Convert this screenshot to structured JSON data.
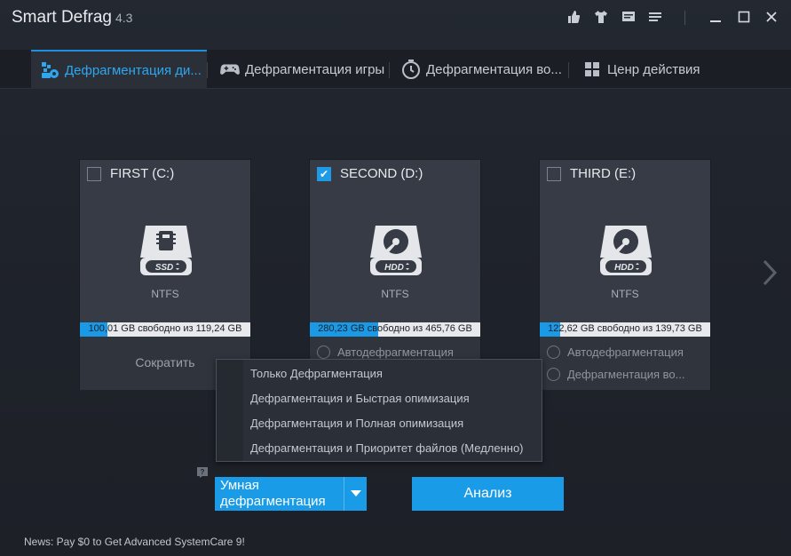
{
  "window": {
    "title": "Smart Defrag",
    "version": "4.3"
  },
  "toolbar_icons": [
    "thumbs-up-icon",
    "tshirt-icon",
    "message-icon",
    "menu-icon"
  ],
  "tabs": [
    {
      "label": "Дефрагментация ди...",
      "icon": "defrag-disk-icon",
      "active": true
    },
    {
      "label": "Дефрагментация игры",
      "icon": "gamepad-icon",
      "active": false
    },
    {
      "label": "Дефрагментация во...",
      "icon": "clock-icon",
      "active": false
    },
    {
      "label": "Ценр действия",
      "icon": "grid-icon",
      "active": false
    }
  ],
  "drives": [
    {
      "name": "FIRST (C:)",
      "checked": false,
      "type_label": "SSD",
      "fs": "NTFS",
      "usage_text": "100,01 GB свободно из 119,24 GB",
      "used_fraction": 0.16,
      "action_label": "Сократить"
    },
    {
      "name": "SECOND (D:)",
      "checked": true,
      "type_label": "HDD",
      "fs": "NTFS",
      "usage_text": "280,23 GB свободно из 465,76 GB",
      "used_fraction": 0.4,
      "option1": "Автодефрагментация"
    },
    {
      "name": "THIRD (E:)",
      "checked": false,
      "type_label": "HDD",
      "fs": "NTFS",
      "usage_text": "122,62 GB свободно из 139,73 GB",
      "used_fraction": 0.12,
      "option1": "Автодефрагментация",
      "option2": "Дефрагментация во..."
    }
  ],
  "menu": {
    "items": [
      "Только Дефрагментация",
      "Дефрагментация и Быстрая опимизация",
      "Дефрагментация и Полная опимизация",
      "Дефрагментация и Приоритет файлов (Медленно)"
    ]
  },
  "mode_select": {
    "value": "Умная дефрагментация"
  },
  "analyze_label": "Анализ",
  "news": "News: Pay $0 to Get Advanced SystemCare 9!",
  "colors": {
    "accent": "#1a9be8",
    "background": "#1d2128",
    "card": "#363b45"
  }
}
